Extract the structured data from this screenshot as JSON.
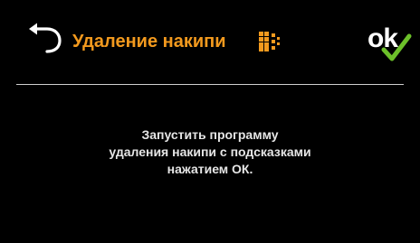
{
  "header": {
    "title": "Удаление накипи",
    "back_icon": "back-arrow-icon",
    "program_icon": "descaling-program-icon",
    "ok_label": "ok",
    "ok_icon": "checkmark-icon"
  },
  "message": {
    "lines": [
      "Запустить программу",
      "удаления накипи с подсказками",
      "нажатием ОК."
    ]
  },
  "colors": {
    "background": "#000000",
    "title": "#f39a1e",
    "check": "#6cc02a",
    "text": "#e6e6e6",
    "divider": "#cfcfcf"
  }
}
